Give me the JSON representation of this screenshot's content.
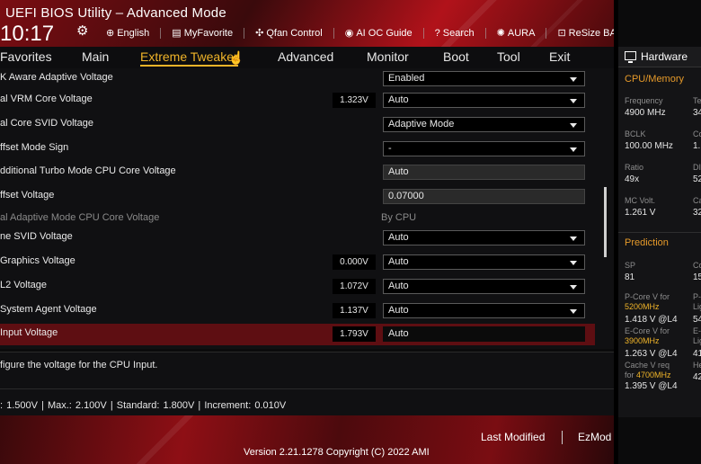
{
  "header": {
    "title": "UEFI BIOS Utility – Advanced Mode",
    "time": "10:17",
    "tools": [
      {
        "icon": "globe-icon",
        "glyph": "⊕",
        "label": "English"
      },
      {
        "icon": "favorite-icon",
        "glyph": "▤",
        "label": "MyFavorite"
      },
      {
        "icon": "fan-icon",
        "glyph": "✣",
        "label": "Qfan Control"
      },
      {
        "icon": "ai-oc-icon",
        "glyph": "◉",
        "label": "AI OC Guide"
      },
      {
        "icon": "search-icon",
        "glyph": "?",
        "label": "Search"
      },
      {
        "icon": "aura-icon",
        "glyph": "✺",
        "label": "AURA"
      },
      {
        "icon": "resize-bar-icon",
        "glyph": "⊡",
        "label": "ReSize BAR"
      }
    ]
  },
  "menu": {
    "items": [
      "Favorites",
      "Main",
      "Extreme Tweaker",
      "Advanced",
      "Monitor",
      "Boot",
      "Tool",
      "Exit"
    ],
    "active_index": 2,
    "accent": "#f0b429"
  },
  "settings": [
    {
      "label": "K Aware Adaptive Voltage",
      "value": "",
      "control": "Enabled",
      "type": "dropdown"
    },
    {
      "label": "al VRM Core Voltage",
      "value": "1.323V",
      "control": "Auto",
      "type": "dropdown"
    },
    {
      "label": "al Core SVID Voltage",
      "value": "",
      "control": "Adaptive Mode",
      "type": "dropdown"
    },
    {
      "label": "ffset Mode Sign",
      "value": "",
      "control": "-",
      "type": "dropdown"
    },
    {
      "label": "dditional Turbo Mode CPU Core Voltage",
      "value": "",
      "control": "Auto",
      "type": "static"
    },
    {
      "label": "ffset Voltage",
      "value": "",
      "control": "0.07000",
      "type": "static"
    },
    {
      "label": "al Adaptive Mode CPU Core Voltage",
      "value": "",
      "control": "By CPU",
      "type": "plain"
    },
    {
      "label": "ne SVID Voltage",
      "value": "",
      "control": "Auto",
      "type": "dropdown"
    },
    {
      "label": "Graphics Voltage",
      "value": "0.000V",
      "control": "Auto",
      "type": "dropdown"
    },
    {
      "label": "L2 Voltage",
      "value": "1.072V",
      "control": "Auto",
      "type": "dropdown"
    },
    {
      "label": "System Agent Voltage",
      "value": "1.137V",
      "control": "Auto",
      "type": "dropdown"
    },
    {
      "label": "Input Voltage",
      "value": "1.793V",
      "control": "Auto",
      "type": "input"
    }
  ],
  "selected_index": 11,
  "help_text": "figure the voltage for the CPU Input.",
  "limits_text": ": 1.500V   |   Max.: 2.100V   |   Standard: 1.800V   |   Increment: 0.010V",
  "footer": {
    "last_modified": "Last Modified",
    "ezmode": "EzMod",
    "version": "Version 2.21.1278 Copyright (C) 2022 AMI"
  },
  "hardware": {
    "title": "Hardware",
    "cpu_memory_title": "CPU/Memory",
    "stats": [
      {
        "k": "Frequency",
        "v": "4900 MHz",
        "k2": "Te",
        "v2": "34"
      },
      {
        "k": "BCLK",
        "v": "100.00 MHz",
        "k2": "Co",
        "v2": "1."
      },
      {
        "k": "Ratio",
        "v": "49x",
        "k2": "DI",
        "v2": "52"
      },
      {
        "k": "MC Volt.",
        "v": "1.261 V",
        "k2": "Ca",
        "v2": "32"
      }
    ],
    "prediction_title": "Prediction",
    "sp_label": "SP",
    "sp_value": "81",
    "sp_k2": "Co",
    "sp_v2": "15",
    "pcore_label": "P-Core V for",
    "pcore_freq": "5200MHz",
    "pcore_value": "1.418 V @L4",
    "pcore_k2": "P-",
    "pcore_k2b": "Lig",
    "pcore_v2": "54",
    "ecore_label": "E-Core V for",
    "ecore_freq": "3900MHz",
    "ecore_value": "1.263 V @L4",
    "ecore_k2": "E-",
    "ecore_k2b": "Lig",
    "ecore_v2": "41",
    "cache_label": "Cache V req",
    "cache_for": "for",
    "cache_freq": "4700MHz",
    "cache_value": "1.395 V @L4",
    "cache_k2": "He",
    "cache_v2": "42"
  }
}
